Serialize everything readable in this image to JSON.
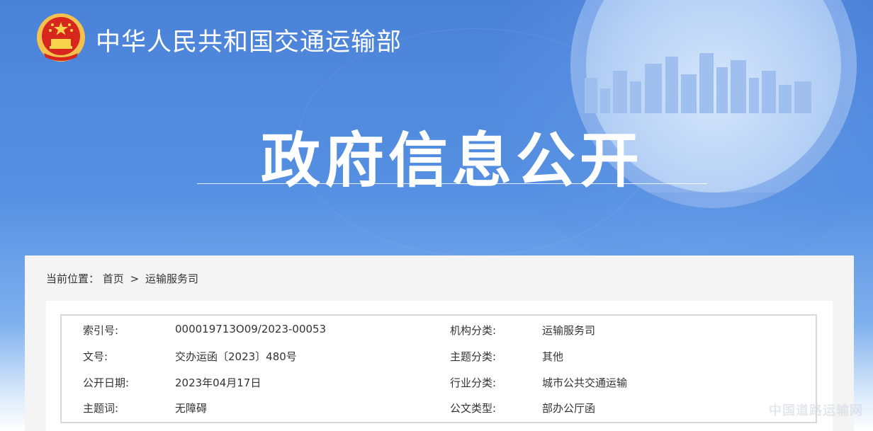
{
  "header": {
    "ministry_name": "中华人民共和国交通运输部",
    "page_title": "政府信息公开"
  },
  "breadcrumb": {
    "label": "当前位置：",
    "home": "首页",
    "separator": ">",
    "current": "运输服务司"
  },
  "info": {
    "rows": [
      {
        "k1": "索引号:",
        "v1": "000019713O09/2023-00053",
        "k2": "机构分类:",
        "v2": "运输服务司"
      },
      {
        "k1": "文号:",
        "v1": "交办运函〔2023〕480号",
        "k2": "主题分类:",
        "v2": "其他"
      },
      {
        "k1": "公开日期:",
        "v1": "2023年04月17日",
        "k2": "行业分类:",
        "v2": "城市公共交通运输"
      },
      {
        "k1": "主题词:",
        "v1": "无障碍",
        "k2": "公文类型:",
        "v2": "部办公厅函"
      }
    ]
  },
  "watermark": "中国道路运输网",
  "colors": {
    "banner": "#4a82d8",
    "text": "#333333",
    "content_bg": "#f4f4f4",
    "border": "#d8d8d8"
  }
}
